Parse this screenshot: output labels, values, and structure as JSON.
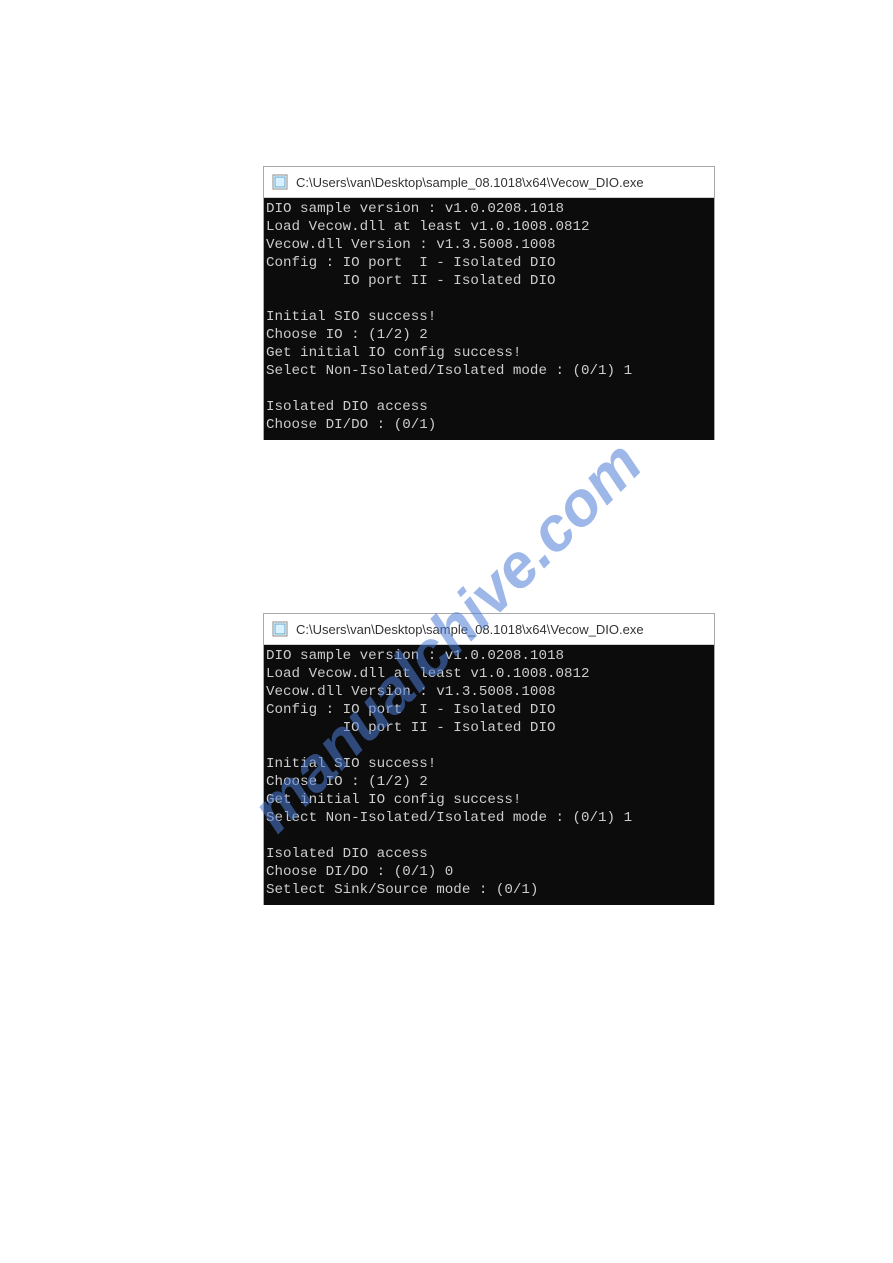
{
  "watermark": {
    "text": "manualchive.com"
  },
  "windows": [
    {
      "title": "C:\\Users\\van\\Desktop\\sample_08.1018\\x64\\Vecow_DIO.exe",
      "lines": [
        "DIO sample version : v1.0.0208.1018",
        "Load Vecow.dll at least v1.0.1008.0812",
        "Vecow.dll Version : v1.3.5008.1008",
        "Config : IO port  I - Isolated DIO",
        "         IO port II - Isolated DIO",
        "",
        "Initial SIO success!",
        "Choose IO : (1/2) 2",
        "Get initial IO config success!",
        "Select Non-Isolated/Isolated mode : (0/1) 1",
        "",
        "Isolated DIO access",
        "Choose DI/DO : (0/1)"
      ]
    },
    {
      "title": "C:\\Users\\van\\Desktop\\sample_08.1018\\x64\\Vecow_DIO.exe",
      "lines": [
        "DIO sample version : v1.0.0208.1018",
        "Load Vecow.dll at least v1.0.1008.0812",
        "Vecow.dll Version : v1.3.5008.1008",
        "Config : IO port  I - Isolated DIO",
        "         IO port II - Isolated DIO",
        "",
        "Initial SIO success!",
        "Choose IO : (1/2) 2",
        "Get initial IO config success!",
        "Select Non-Isolated/Isolated mode : (0/1) 1",
        "",
        "Isolated DIO access",
        "Choose DI/DO : (0/1) 0",
        "Setlect Sink/Source mode : (0/1)"
      ]
    }
  ]
}
